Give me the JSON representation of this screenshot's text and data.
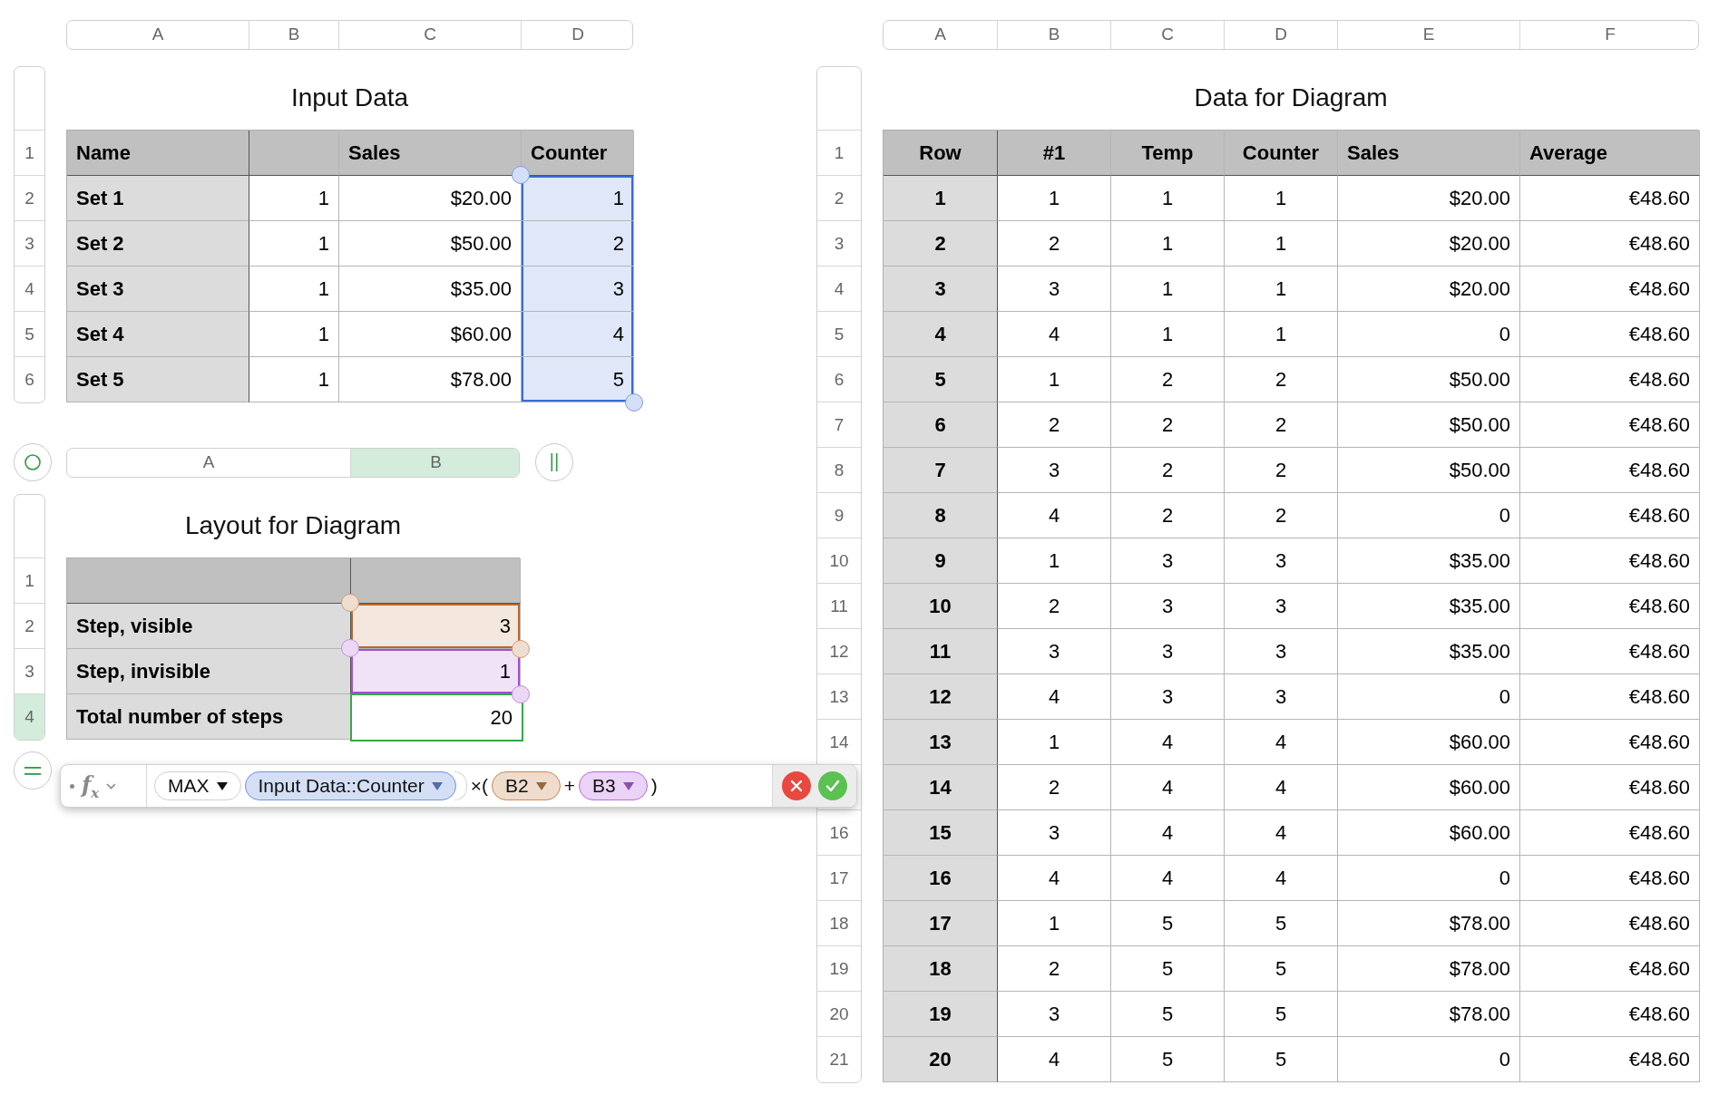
{
  "sheets": [
    {
      "title": "Input Data",
      "columns": [
        {
          "letter": "A",
          "heading": "Name",
          "selected": false
        },
        {
          "letter": "B",
          "selected": false
        },
        {
          "letter": "C",
          "heading": "Sales",
          "selected": false
        },
        {
          "letter": "D",
          "heading": "Counter",
          "selected": false
        }
      ],
      "row_numbers": [
        {
          "label": "1",
          "selected": false
        },
        {
          "label": "2",
          "selected": false
        },
        {
          "label": "3",
          "selected": false
        },
        {
          "label": "4",
          "selected": false
        },
        {
          "label": "5",
          "selected": false
        },
        {
          "label": "6",
          "selected": false
        }
      ],
      "rows": [
        [
          "Set 1",
          "1",
          "$20.00",
          {
            "text": "1",
            "kind": "range",
            "color": "#3a6ad6"
          }
        ],
        [
          "Set 2",
          "1",
          "$50.00",
          {
            "text": "2",
            "kind": "range",
            "color": "#3a6ad6"
          }
        ],
        [
          "Set 3",
          "1",
          "$35.00",
          {
            "text": "3",
            "kind": "range",
            "color": "#3a6ad6"
          }
        ],
        [
          "Set 4",
          "1",
          "$60.00",
          {
            "text": "4",
            "kind": "range",
            "color": "#3a6ad6"
          }
        ],
        [
          "Set 5",
          "1",
          "$78.00",
          {
            "text": "5",
            "kind": "range",
            "color": "#3a6ad6"
          }
        ]
      ]
    },
    {
      "title": "Layout for Diagram",
      "handles": true,
      "columns": [
        {
          "letter": "A",
          "selected": false
        },
        {
          "letter": "B",
          "selected": true
        }
      ],
      "row_numbers": [
        {
          "label": "1",
          "selected": false
        },
        {
          "label": "2",
          "selected": false
        },
        {
          "label": "3",
          "selected": false
        },
        {
          "label": "4",
          "selected": true
        }
      ],
      "rows": [
        [
          "Step, visible",
          {
            "text": "3",
            "kind": "range",
            "color": "#b8682a"
          }
        ],
        [
          "Step, invisible",
          {
            "text": "1",
            "kind": "range",
            "color": "#a64fd0"
          }
        ],
        [
          "Total number of steps",
          {
            "text": "20",
            "kind": "edit",
            "color": "#3aa54a"
          }
        ]
      ]
    },
    {
      "title": "Data for Diagram",
      "columns": [
        {
          "letter": "A",
          "heading": "Row",
          "selected": false
        },
        {
          "letter": "B",
          "heading": "#1",
          "selected": false
        },
        {
          "letter": "C",
          "heading": "Temp",
          "selected": false
        },
        {
          "letter": "D",
          "heading": "Counter",
          "selected": false
        },
        {
          "letter": "E",
          "heading": "Sales",
          "selected": false
        },
        {
          "letter": "F",
          "heading": "Average",
          "selected": false
        }
      ],
      "row_numbers": [
        {
          "label": "1",
          "selected": false
        },
        {
          "label": "2",
          "selected": false
        },
        {
          "label": "3",
          "selected": false
        },
        {
          "label": "4",
          "selected": false
        },
        {
          "label": "5",
          "selected": false
        },
        {
          "label": "6",
          "selected": false
        },
        {
          "label": "7",
          "selected": false
        },
        {
          "label": "8",
          "selected": false
        },
        {
          "label": "9",
          "selected": false
        },
        {
          "label": "10",
          "selected": false
        },
        {
          "label": "11",
          "selected": false
        },
        {
          "label": "12",
          "selected": false
        },
        {
          "label": "13",
          "selected": false
        },
        {
          "label": "14",
          "selected": false
        },
        {
          "selected": false
        },
        {
          "label": "16",
          "selected": false
        },
        {
          "label": "17",
          "selected": false
        },
        {
          "label": "18",
          "selected": false
        },
        {
          "label": "19",
          "selected": false
        },
        {
          "label": "20",
          "selected": false
        },
        {
          "label": "21",
          "selected": false
        }
      ],
      "rows": [
        [
          "1",
          "1",
          "1",
          "1",
          "$20.00",
          "€48.60"
        ],
        [
          "2",
          "2",
          "1",
          "1",
          "$20.00",
          "€48.60"
        ],
        [
          "3",
          "3",
          "1",
          "1",
          "$20.00",
          "€48.60"
        ],
        [
          "4",
          "4",
          "1",
          "1",
          "0",
          "€48.60"
        ],
        [
          "5",
          "1",
          "2",
          "2",
          "$50.00",
          "€48.60"
        ],
        [
          "6",
          "2",
          "2",
          "2",
          "$50.00",
          "€48.60"
        ],
        [
          "7",
          "3",
          "2",
          "2",
          "$50.00",
          "€48.60"
        ],
        [
          "8",
          "4",
          "2",
          "2",
          "0",
          "€48.60"
        ],
        [
          "9",
          "1",
          "3",
          "3",
          "$35.00",
          "€48.60"
        ],
        [
          "10",
          "2",
          "3",
          "3",
          "$35.00",
          "€48.60"
        ],
        [
          "11",
          "3",
          "3",
          "3",
          "$35.00",
          "€48.60"
        ],
        [
          "12",
          "4",
          "3",
          "3",
          "0",
          "€48.60"
        ],
        [
          "13",
          "1",
          "4",
          "4",
          "$60.00",
          "€48.60"
        ],
        [
          "14",
          "2",
          "4",
          "4",
          "$60.00",
          "€48.60"
        ],
        [
          "15",
          "3",
          "4",
          "4",
          "$60.00",
          "€48.60"
        ],
        [
          "16",
          "4",
          "4",
          "4",
          "0",
          "€48.60"
        ],
        [
          "17",
          "1",
          "5",
          "5",
          "$78.00",
          "€48.60"
        ],
        [
          "18",
          "2",
          "5",
          "5",
          "$78.00",
          "€48.60"
        ],
        [
          "19",
          "3",
          "5",
          "5",
          "$78.00",
          "€48.60"
        ],
        [
          "20",
          "4",
          "5",
          "5",
          "0",
          "€48.60"
        ]
      ]
    }
  ],
  "formula_bar": {
    "label": "f$_{x}$",
    "tokens": [
      {
        "kind": "function",
        "text": "MAX"
      },
      {
        "kind": "reference",
        "text": "Input Data::Counter",
        "color": "#6f93e0"
      },
      {
        "kind": "operator",
        "text": "×("
      },
      {
        "kind": "reference",
        "text": "B2",
        "color": "#c98a55"
      },
      {
        "kind": "operator",
        "text": "+"
      },
      {
        "kind": "reference",
        "text": "B3",
        "color": "#b86ce0"
      },
      {
        "kind": "operator",
        "text": ")"
      }
    ]
  }
}
